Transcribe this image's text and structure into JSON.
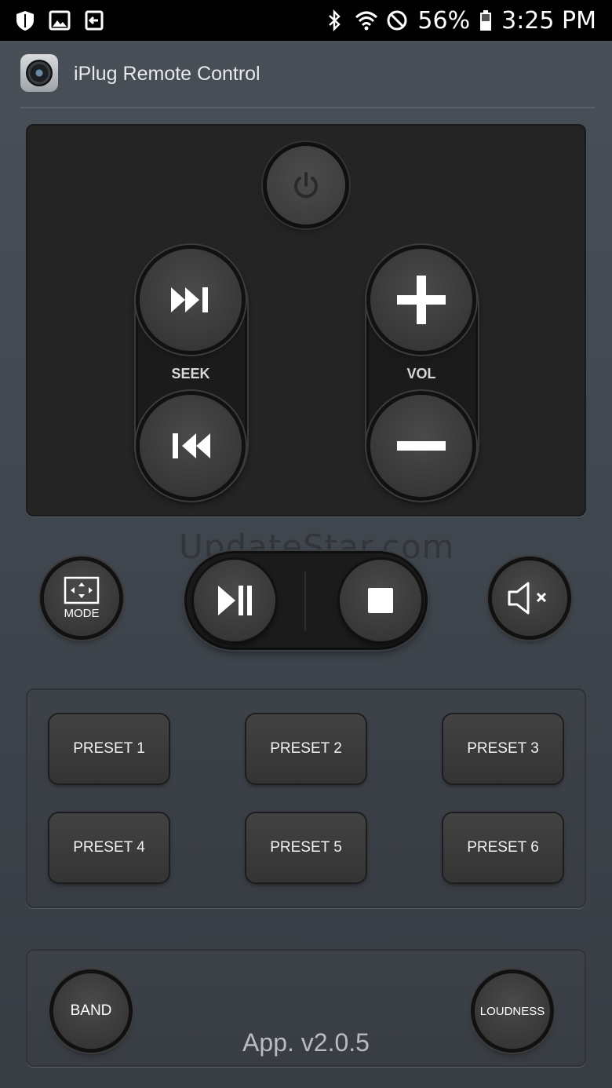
{
  "status_bar": {
    "battery": "56%",
    "time": "3:25 PM",
    "left_icons": [
      "shield-icon",
      "image-icon",
      "exit-icon"
    ],
    "right_icons": [
      "bluetooth-icon",
      "wifi-icon",
      "do-not-disturb-icon",
      "battery-icon"
    ]
  },
  "app_bar": {
    "title": "iPlug Remote Control",
    "logo": "speaker-logo-icon"
  },
  "controls": {
    "power": "power-icon",
    "seek_label": "SEEK",
    "vol_label": "VOL",
    "mode_label": "MODE",
    "mute": "mute-icon"
  },
  "watermark": "UpdateStar.com",
  "presets": [
    {
      "label": "PRESET 1"
    },
    {
      "label": "PRESET 2"
    },
    {
      "label": "PRESET 3"
    },
    {
      "label": "PRESET 4"
    },
    {
      "label": "PRESET 5"
    },
    {
      "label": "PRESET 6"
    }
  ],
  "bottom": {
    "band_label": "BAND",
    "loudness_label": "LOUDNESS",
    "version": "App. v2.0.5"
  },
  "colors": {
    "background": "#40464e",
    "panel_dark": "#242424",
    "button": "#3a3a3a",
    "text": "#ffffff"
  }
}
